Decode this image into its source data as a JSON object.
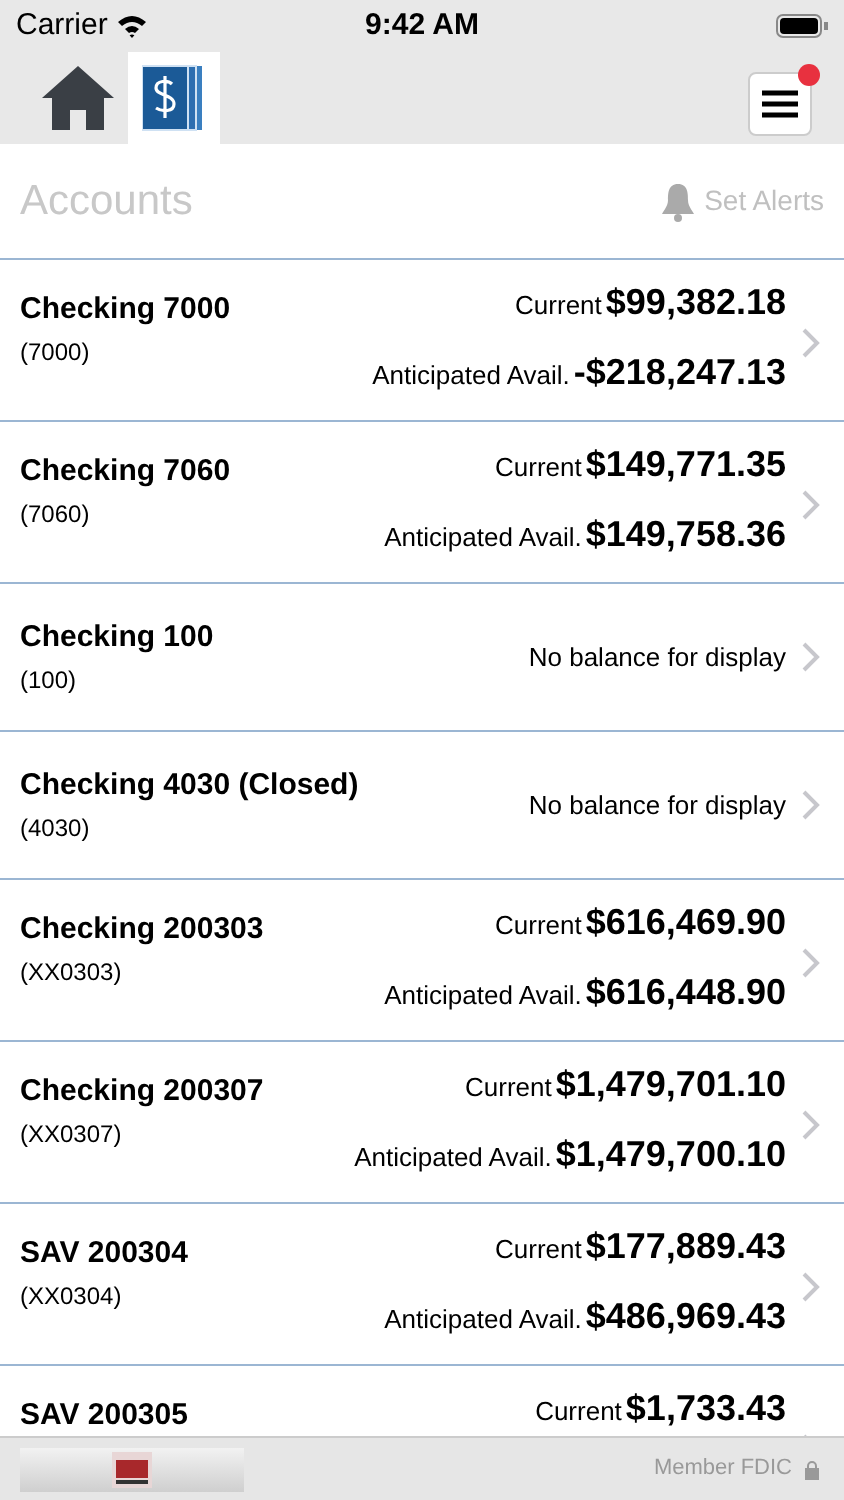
{
  "status_bar": {
    "carrier": "Carrier",
    "time": "9:42 AM"
  },
  "tabs": [
    {
      "kind": "home",
      "selected": false
    },
    {
      "kind": "accounts",
      "selected": true
    }
  ],
  "menu": {
    "notification": true
  },
  "header": {
    "title": "Accounts",
    "action": "Set Alerts"
  },
  "accounts": [
    {
      "name": "Checking 7000",
      "number": "(7000)",
      "kind": "balance",
      "current_label": "Current",
      "current": "$99,382.18",
      "avail_label": "Anticipated Avail.",
      "avail": "-$218,247.13"
    },
    {
      "name": "Checking 7060",
      "number": "(7060)",
      "kind": "balance",
      "current_label": "Current",
      "current": "$149,771.35",
      "avail_label": "Anticipated Avail.",
      "avail": "$149,758.36"
    },
    {
      "name": "Checking 100",
      "number": "(100)",
      "kind": "none",
      "message": "No balance for display"
    },
    {
      "name": "Checking 4030 (Closed)",
      "number": "(4030)",
      "kind": "none",
      "message": "No balance for display"
    },
    {
      "name": "Checking 200303",
      "number": "(XX0303)",
      "kind": "balance",
      "current_label": "Current",
      "current": "$616,469.90",
      "avail_label": "Anticipated Avail.",
      "avail": "$616,448.90"
    },
    {
      "name": "Checking 200307",
      "number": "(XX0307)",
      "kind": "balance",
      "current_label": "Current",
      "current": "$1,479,701.10",
      "avail_label": "Anticipated Avail.",
      "avail": "$1,479,700.10"
    },
    {
      "name": "SAV 200304",
      "number": "(XX0304)",
      "kind": "balance",
      "current_label": "Current",
      "current": "$177,889.43",
      "avail_label": "Anticipated Avail.",
      "avail": "$486,969.43"
    },
    {
      "name": "SAV 200305",
      "kind": "balance",
      "current_label": "Current",
      "current": "$1,733.43"
    }
  ],
  "footer": {
    "text": "Member FDIC"
  }
}
